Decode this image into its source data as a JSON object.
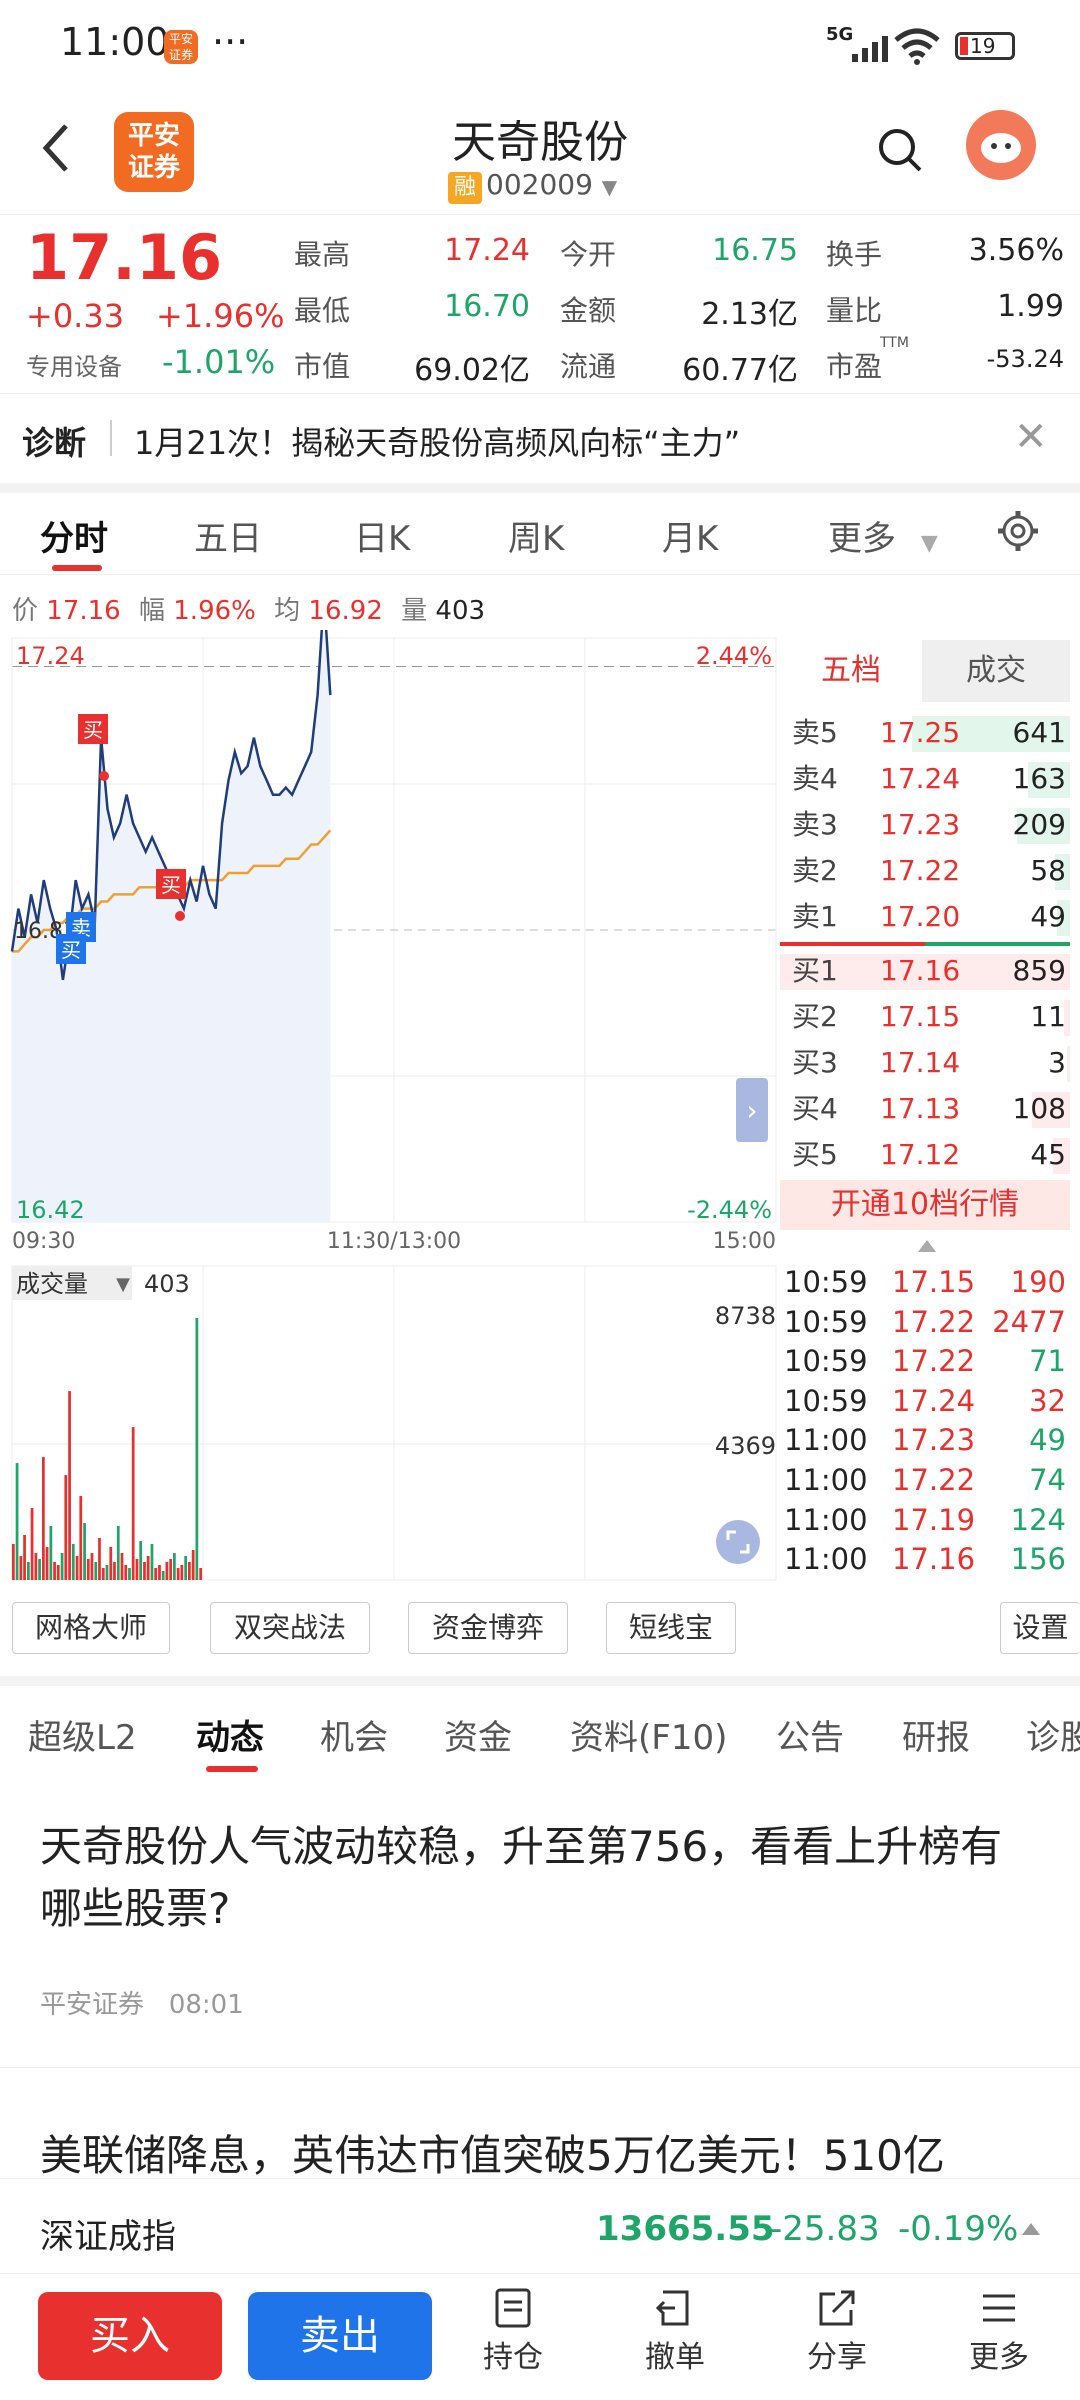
{
  "status_bar": {
    "time": "11:00",
    "app_icon_text": "平安\n证券",
    "dots": "···",
    "signal": "5G",
    "battery": "19"
  },
  "header": {
    "logo_text": "平安\n证券",
    "stock_name": "天奇股份",
    "rong": "融",
    "code": "002009"
  },
  "quote": {
    "price": "17.16",
    "change": "+0.33",
    "change_pct": "+1.96%",
    "industry_label": "专用设备",
    "industry_change": "-1.01%",
    "fields": [
      {
        "label": "最高",
        "value": "17.24",
        "color": "#e8312f"
      },
      {
        "label": "最低",
        "value": "16.70",
        "color": "#1ea56a"
      },
      {
        "label": "市值",
        "value": "69.02亿",
        "color": "#222222"
      },
      {
        "label": "今开",
        "value": "16.75",
        "color": "#1ea56a"
      },
      {
        "label": "金额",
        "value": "2.13亿",
        "color": "#222222"
      },
      {
        "label": "流通",
        "value": "60.77亿",
        "color": "#222222"
      },
      {
        "label": "换手",
        "value": "3.56%",
        "color": "#222222"
      },
      {
        "label": "量比",
        "value": "1.99",
        "color": "#222222"
      },
      {
        "label": "市盈",
        "value": "-53.24",
        "color": "#222222",
        "sup": "TTM"
      }
    ]
  },
  "diagnosis": {
    "label": "诊断",
    "news": "1月21次！揭秘天奇股份高频风向标“主力”"
  },
  "chart_tabs": [
    "分时",
    "五日",
    "日K",
    "周K",
    "月K",
    "更多"
  ],
  "intraday_info": {
    "price_label": "价",
    "price": "17.16",
    "range_label": "幅",
    "range": "1.96%",
    "avg_label": "均",
    "avg": "16.92",
    "vol_label": "量",
    "vol": "403"
  },
  "chart_data": {
    "type": "line",
    "title": "",
    "price_axis": {
      "top": "17.24",
      "bottom": "16.42",
      "top_pct": "2.44%",
      "bottom_pct": "-2.44%",
      "mid_label": "16.83",
      "ylim": [
        16.42,
        17.24
      ]
    },
    "x_labels": [
      "09:30",
      "11:30/13:00",
      "15:00"
    ],
    "series": [
      {
        "name": "价",
        "color": "#1f3d7a",
        "values": [
          16.8,
          16.86,
          16.82,
          16.88,
          16.84,
          16.9,
          16.86,
          16.83,
          16.76,
          16.82,
          16.9,
          16.86,
          16.88,
          16.84,
          17.1,
          17.0,
          16.96,
          16.98,
          17.02,
          16.98,
          16.96,
          16.94,
          16.96,
          16.94,
          16.92,
          16.9,
          16.88,
          16.86,
          16.9,
          16.87,
          16.92,
          16.88,
          16.86,
          16.98,
          17.04,
          17.08,
          17.05,
          17.06,
          17.1,
          17.06,
          17.04,
          17.02,
          17.02,
          17.03,
          17.02,
          17.04,
          17.06,
          17.08,
          17.16,
          17.3,
          17.16
        ]
      },
      {
        "name": "均",
        "color": "#f0a030",
        "values": [
          16.8,
          16.8,
          16.81,
          16.82,
          16.82,
          16.83,
          16.83,
          16.84,
          16.84,
          16.85,
          16.85,
          16.86,
          16.86,
          16.86,
          16.87,
          16.87,
          16.88,
          16.88,
          16.88,
          16.88,
          16.89,
          16.89,
          16.89,
          16.89,
          16.89,
          16.89,
          16.89,
          16.89,
          16.9,
          16.9,
          16.9,
          16.9,
          16.9,
          16.9,
          16.91,
          16.91,
          16.91,
          16.91,
          16.92,
          16.92,
          16.92,
          16.92,
          16.92,
          16.93,
          16.93,
          16.93,
          16.94,
          16.95,
          16.95,
          16.96,
          16.97
        ]
      }
    ],
    "markers": [
      {
        "text": "买",
        "color": "#e8312f"
      },
      {
        "text": "买",
        "color": "#e8312f"
      },
      {
        "text": "卖",
        "color": "#1e74e8"
      },
      {
        "text": "买",
        "color": "#1e74e8"
      }
    ],
    "volume": {
      "label": "成交量",
      "current": "403",
      "ticks": [
        "8738",
        "4369"
      ],
      "ylim": [
        0,
        8738
      ],
      "values": [
        1200,
        3900,
        800,
        1500,
        600,
        2400,
        900,
        700,
        4100,
        1100,
        1800,
        600,
        500,
        900,
        3500,
        6300,
        1200,
        800,
        2800,
        1900,
        700,
        900,
        600,
        1400,
        400,
        500,
        1100,
        600,
        1800,
        900,
        500,
        400,
        5100,
        700,
        1300,
        600,
        800,
        1200,
        400,
        500,
        300,
        600,
        700,
        900,
        400,
        500,
        800,
        600,
        1000,
        8738,
        400
      ],
      "up_color": "#e8312f",
      "down_color": "#1ea56a"
    }
  },
  "order_book": {
    "tab_active": "五档",
    "tab_other": "成交",
    "asks": [
      {
        "label": "卖5",
        "price": "17.25",
        "vol": "641",
        "bar": 0.75
      },
      {
        "label": "卖4",
        "price": "17.24",
        "vol": "163",
        "bar": 0.2
      },
      {
        "label": "卖3",
        "price": "17.23",
        "vol": "209",
        "bar": 0.25
      },
      {
        "label": "卖2",
        "price": "17.22",
        "vol": "58",
        "bar": 0.07
      },
      {
        "label": "卖1",
        "price": "17.20",
        "vol": "49",
        "bar": 0.06
      }
    ],
    "bids": [
      {
        "label": "买1",
        "price": "17.16",
        "vol": "859",
        "bar": 1.0
      },
      {
        "label": "买2",
        "price": "17.15",
        "vol": "11",
        "bar": 0.02
      },
      {
        "label": "买3",
        "price": "17.14",
        "vol": "3",
        "bar": 0.01
      },
      {
        "label": "买4",
        "price": "17.13",
        "vol": "108",
        "bar": 0.13
      },
      {
        "label": "买5",
        "price": "17.12",
        "vol": "45",
        "bar": 0.06
      }
    ],
    "open_10": "开通10档行情"
  },
  "trades": [
    {
      "time": "10:59",
      "price": "17.15",
      "vol": "190",
      "color": "#e8312f"
    },
    {
      "time": "10:59",
      "price": "17.22",
      "vol": "2477",
      "color": "#e8312f"
    },
    {
      "time": "10:59",
      "price": "17.22",
      "vol": "71",
      "color": "#1ea56a"
    },
    {
      "time": "10:59",
      "price": "17.24",
      "vol": "32",
      "color": "#e8312f"
    },
    {
      "time": "11:00",
      "price": "17.23",
      "vol": "49",
      "color": "#1ea56a"
    },
    {
      "time": "11:00",
      "price": "17.22",
      "vol": "74",
      "color": "#1ea56a"
    },
    {
      "time": "11:00",
      "price": "17.19",
      "vol": "124",
      "color": "#1ea56a"
    },
    {
      "time": "11:00",
      "price": "17.16",
      "vol": "156",
      "color": "#1ea56a"
    }
  ],
  "tools": [
    "网格大师",
    "双突战法",
    "资金博弈",
    "短线宝",
    "设置"
  ],
  "news_tabs": [
    "超级L2",
    "动态",
    "机会",
    "资金",
    "资料(F10)",
    "公告",
    "研报",
    "诊股"
  ],
  "articles": [
    {
      "title": "天奇股份人气波动较稳，升至第756，看看上升榜有哪些股票?",
      "source": "平安证券",
      "time": "08:01"
    },
    {
      "title": "美联储降息，英伟达市值突破5万亿美元！510亿"
    }
  ],
  "index_bar": {
    "name": "深证成指",
    "value": "13665.55",
    "change": "-25.83",
    "pct": "-0.19%"
  },
  "bottom_nav": {
    "buy": "买入",
    "sell": "卖出",
    "items": [
      "持仓",
      "撤单",
      "分享",
      "更多"
    ]
  }
}
